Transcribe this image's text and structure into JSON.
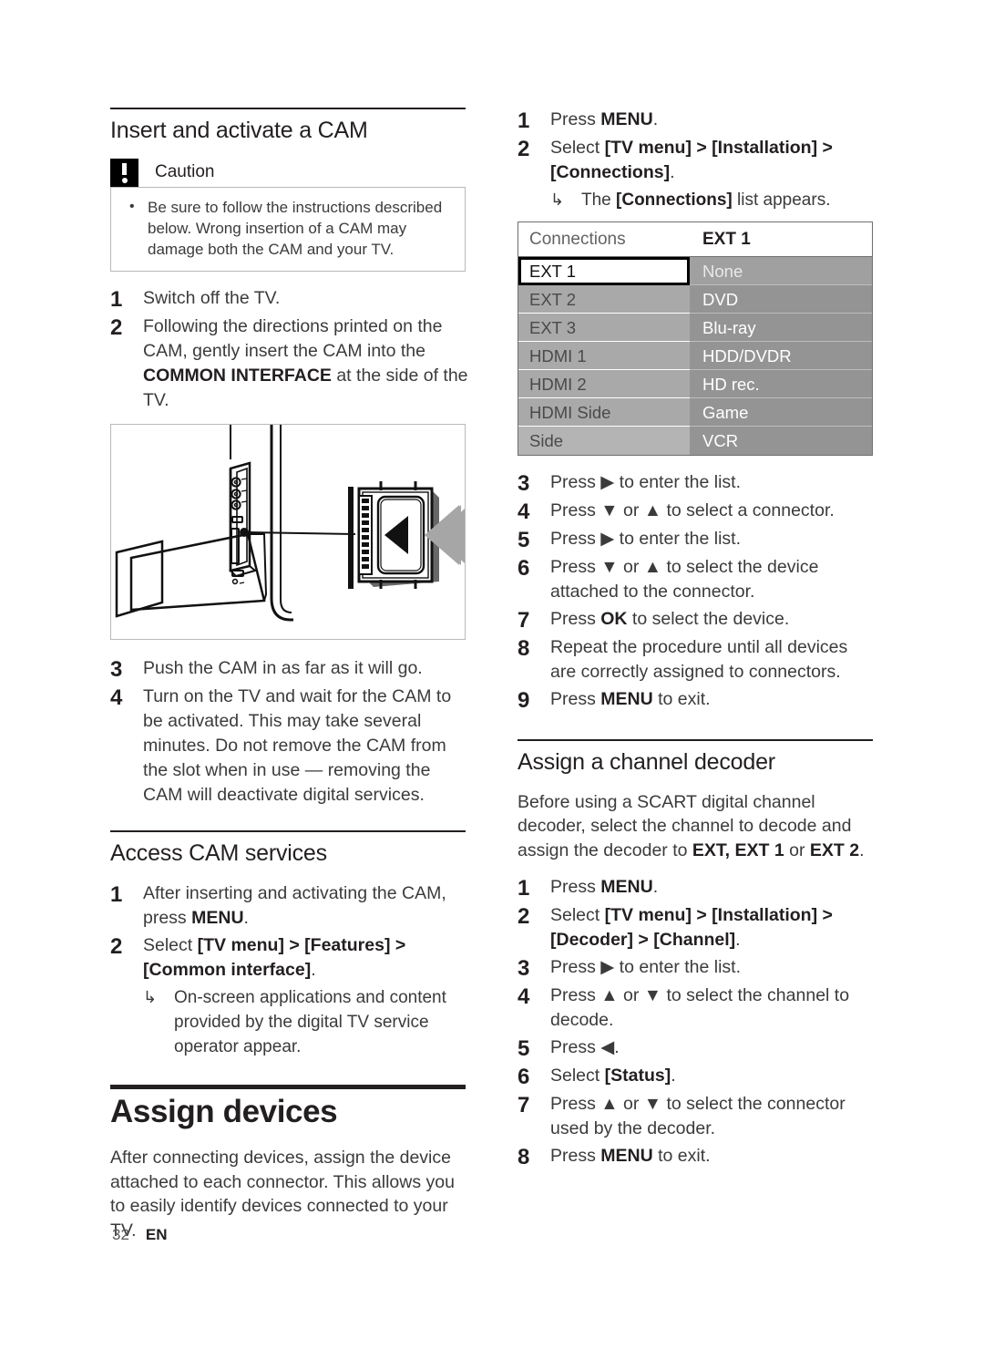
{
  "page": {
    "number": "32",
    "language": "EN"
  },
  "left_column": {
    "section1": {
      "heading": "Insert and activate a CAM",
      "caution": {
        "label": "Caution",
        "items": [
          "Be sure to follow the instructions described below. Wrong insertion of a CAM may damage both the CAM and your TV."
        ]
      },
      "steps_before_figure": [
        {
          "num": "1",
          "text": "Switch off the TV."
        },
        {
          "num": "2",
          "text_pre": "Following the directions printed on the CAM, gently insert the CAM into the ",
          "text_bold": "COMMON INTERFACE",
          "text_post": " at the side of the TV."
        }
      ],
      "figure": {
        "caption": "",
        "alt": "TV side panel with CAM card being inserted into the common interface slot"
      },
      "steps_after_figure": [
        {
          "num": "3",
          "text": "Push the CAM in as far as it will go."
        },
        {
          "num": "4",
          "text": "Turn on the TV and wait for the CAM to be activated. This may take several minutes. Do not remove the CAM from the slot when in use — removing the CAM will deactivate digital services."
        }
      ]
    },
    "section2": {
      "heading": "Access CAM services",
      "steps": [
        {
          "num": "1",
          "text_pre": "After inserting and activating the CAM, press ",
          "text_bold": "MENU",
          "text_post": "."
        },
        {
          "num": "2",
          "text_pre": "Select ",
          "text_bold": "[TV menu] > [Features] > [Common interface]",
          "text_post": "."
        }
      ],
      "subnote": {
        "arrow": "↳",
        "text": "On-screen applications and content provided by the digital TV service operator appear."
      }
    },
    "chapter": {
      "heading": "Assign devices",
      "intro": "After connecting devices, assign the device attached to each connector. This allows you to easily identify devices connected to your TV."
    }
  },
  "right_column": {
    "assign_devices_steps_top": [
      {
        "num": "1",
        "text_pre": "Press ",
        "text_bold": "MENU",
        "text_post": "."
      },
      {
        "num": "2",
        "text_pre": "Select ",
        "text_bold": "[TV menu] > [Installation] > [Connections]",
        "text_post": "."
      }
    ],
    "assign_devices_subnote": {
      "arrow": "↳",
      "text_pre": "The ",
      "text_bold": "[Connections]",
      "text_post": " list appears."
    },
    "connections_table": {
      "header": {
        "left": "Connections",
        "right": "EXT 1"
      },
      "rows": [
        {
          "connector": "EXT 1",
          "device": "None",
          "selected": true
        },
        {
          "connector": "EXT 2",
          "device": "DVD",
          "selected": false
        },
        {
          "connector": "EXT 3",
          "device": "Blu-ray",
          "selected": false
        },
        {
          "connector": "HDMI 1",
          "device": "HDD/DVDR",
          "selected": false
        },
        {
          "connector": "HDMI 2",
          "device": "HD rec.",
          "selected": false
        },
        {
          "connector": "HDMI Side",
          "device": "Game",
          "selected": false
        },
        {
          "connector": "Side",
          "device": "VCR",
          "selected": false
        }
      ]
    },
    "assign_devices_steps_bottom": [
      {
        "num": "3",
        "text_pre": "Press ",
        "glyph": "▶",
        "text_post": " to enter the list."
      },
      {
        "num": "4",
        "text_pre": "Press ",
        "glyph": "▼",
        "mid": " or ",
        "glyph2": "▲",
        "text_post": " to select a connector."
      },
      {
        "num": "5",
        "text_pre": "Press ",
        "glyph": "▶",
        "text_post": " to enter the list."
      },
      {
        "num": "6",
        "text_pre": "Press ",
        "glyph": "▼",
        "mid": " or ",
        "glyph2": "▲",
        "text_post": " to select the device attached to the connector."
      },
      {
        "num": "7",
        "text_pre": "Press ",
        "text_bold": "OK",
        "text_post": " to select the device."
      },
      {
        "num": "8",
        "text": "Repeat the procedure until all devices are correctly assigned to connectors."
      },
      {
        "num": "9",
        "text_pre": "Press ",
        "text_bold": "MENU",
        "text_post": " to exit."
      }
    ],
    "decoder_section": {
      "heading": "Assign a channel decoder",
      "intro_pre": "Before using a SCART digital channel decoder, select the channel to decode and assign the decoder to ",
      "intro_bold": "EXT, EXT 1",
      "intro_mid": " or ",
      "intro_bold2": "EXT 2",
      "intro_post": ".",
      "steps": [
        {
          "num": "1",
          "text_pre": "Press ",
          "text_bold": "MENU",
          "text_post": "."
        },
        {
          "num": "2",
          "text_pre": "Select ",
          "text_bold": "[TV menu] > [Installation] > [Decoder] > [Channel]",
          "text_post": "."
        },
        {
          "num": "3",
          "text_pre": "Press ",
          "glyph": "▶",
          "text_post": " to enter the list."
        },
        {
          "num": "4",
          "text_pre": "Press ",
          "glyph": "▲",
          "mid": " or ",
          "glyph2": "▼",
          "text_post": " to select the channel to decode."
        },
        {
          "num": "5",
          "text_pre": "Press ",
          "glyph": "◀",
          "text_post": "."
        },
        {
          "num": "6",
          "text_pre": "Select ",
          "text_bold": "[Status]",
          "text_post": "."
        },
        {
          "num": "7",
          "text_pre": "Press ",
          "glyph": "▲",
          "mid": " or ",
          "glyph2": "▼",
          "text_post": " to select the connector used by the decoder."
        },
        {
          "num": "8",
          "text_pre": "Press ",
          "text_bold": "MENU",
          "text_post": " to exit."
        }
      ]
    }
  }
}
